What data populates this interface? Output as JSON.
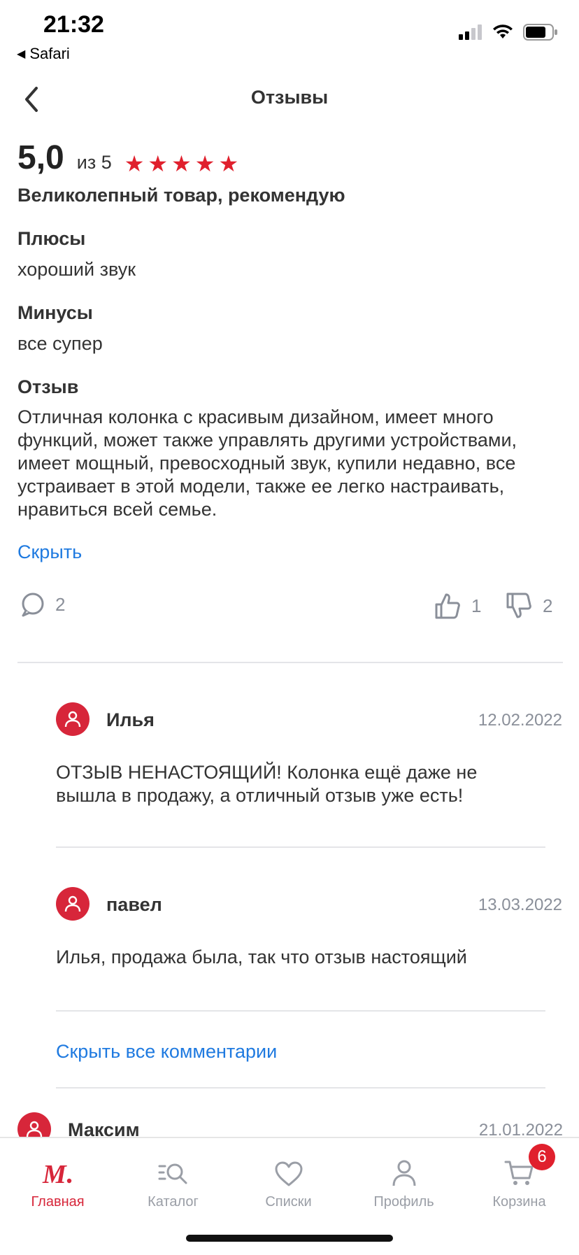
{
  "status_bar": {
    "time": "21:32",
    "back_app": "Safari"
  },
  "header": {
    "title": "Отзывы"
  },
  "review": {
    "rating": "5,0",
    "rating_of": "из 5",
    "stars": 5,
    "headline": "Великолепный товар, рекомендую",
    "pros_title": "Плюсы",
    "pros_text": "хороший звук",
    "cons_title": "Минусы",
    "cons_text": "все супер",
    "review_title": "Отзыв",
    "review_text": "Отличная колонка с красивым дизайном, имеет много функций, может также управлять другими устройствами, имеет мощный, превосходный звук, купили недавно, все устраивает в этой модели, также ее легко настраивать, нравиться всей семье.",
    "hide_label": "Скрыть",
    "comments_count": "2",
    "likes": "1",
    "dislikes": "2"
  },
  "comments": [
    {
      "name": "Илья",
      "date": "12.02.2022",
      "text": "ОТЗЫВ НЕНАСТОЯЩИЙ! Колонка ещё даже не вышла в продажу, а отличный отзыв уже есть!"
    },
    {
      "name": "павел",
      "date": "13.03.2022",
      "text": "Илья, продажа была, так что отзыв настоящий"
    }
  ],
  "hide_all_comments": "Скрыть все комментарии",
  "next_review": {
    "name": "Максим",
    "date": "21.01.2022"
  },
  "tabbar": {
    "items": [
      {
        "label": "Главная",
        "icon": "logo-icon",
        "active": true
      },
      {
        "label": "Каталог",
        "icon": "catalog-search-icon"
      },
      {
        "label": "Списки",
        "icon": "heart-icon"
      },
      {
        "label": "Профиль",
        "icon": "person-icon"
      },
      {
        "label": "Корзина",
        "icon": "cart-icon",
        "badge": "6"
      }
    ]
  },
  "colors": {
    "accent": "#d7263a",
    "star": "#e0202d",
    "link": "#1f7ae0",
    "muted": "#8a8f99"
  }
}
